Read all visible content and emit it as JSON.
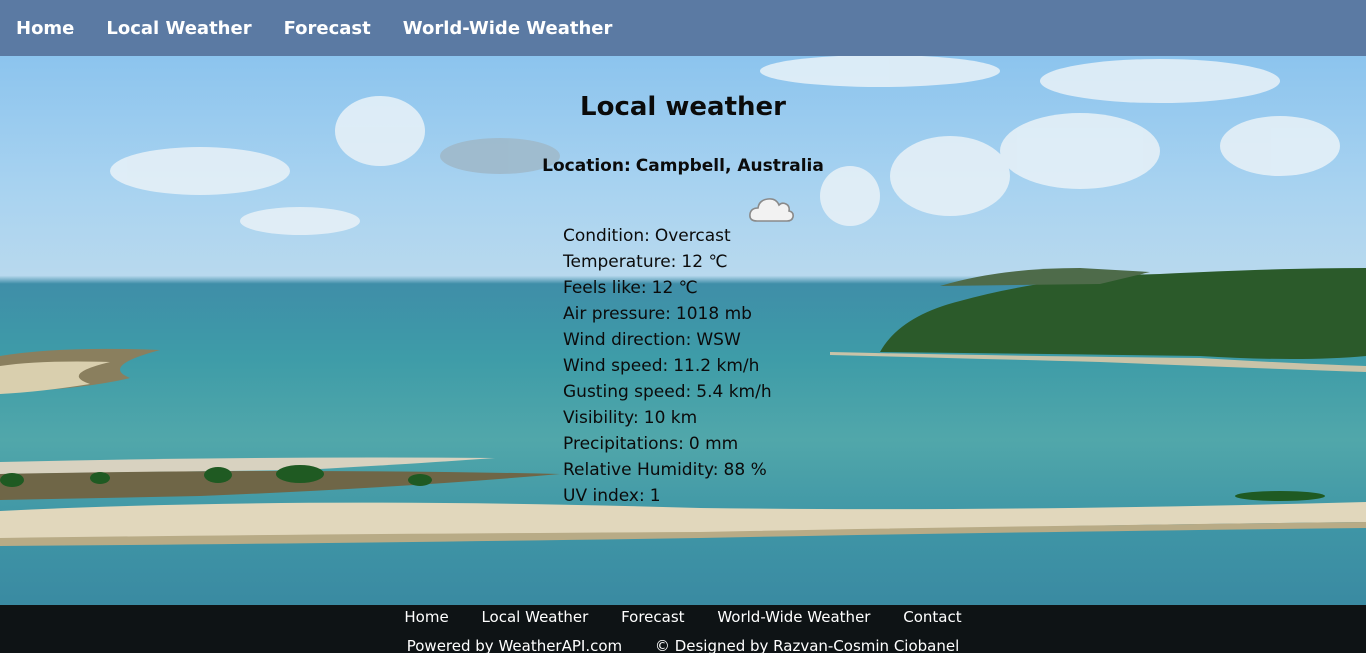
{
  "nav": {
    "items": [
      {
        "label": "Home"
      },
      {
        "label": "Local Weather"
      },
      {
        "label": "Forecast"
      },
      {
        "label": "World-Wide Weather"
      }
    ]
  },
  "main": {
    "title": "Local weather",
    "location_label": "Location:",
    "location_value": "Campbell, Australia",
    "icon": "cloud-icon",
    "details": [
      {
        "label": "Condition:",
        "value": "Overcast"
      },
      {
        "label": "Temperature:",
        "value": "12 ℃"
      },
      {
        "label": "Feels like:",
        "value": "12 ℃"
      },
      {
        "label": "Air pressure:",
        "value": "1018 mb"
      },
      {
        "label": "Wind direction:",
        "value": "WSW"
      },
      {
        "label": "Wind speed:",
        "value": "11.2 km/h"
      },
      {
        "label": "Gusting speed:",
        "value": "5.4 km/h"
      },
      {
        "label": "Visibility:",
        "value": "10 km"
      },
      {
        "label": "Precipitations:",
        "value": "0 mm"
      },
      {
        "label": "Relative Humidity:",
        "value": "88 %"
      },
      {
        "label": "UV index:",
        "value": "1"
      }
    ]
  },
  "footer": {
    "nav": [
      {
        "label": "Home"
      },
      {
        "label": "Local Weather"
      },
      {
        "label": "Forecast"
      },
      {
        "label": "World-Wide Weather"
      },
      {
        "label": "Contact"
      }
    ],
    "powered_by": "Powered by WeatherAPI.com",
    "designed_by": "© Designed by Razvan-Cosmin Ciobanel"
  },
  "colors": {
    "nav_bg": "#5b7aa3",
    "footer_bg": "#0e1315",
    "text": "#0b0b0b"
  }
}
